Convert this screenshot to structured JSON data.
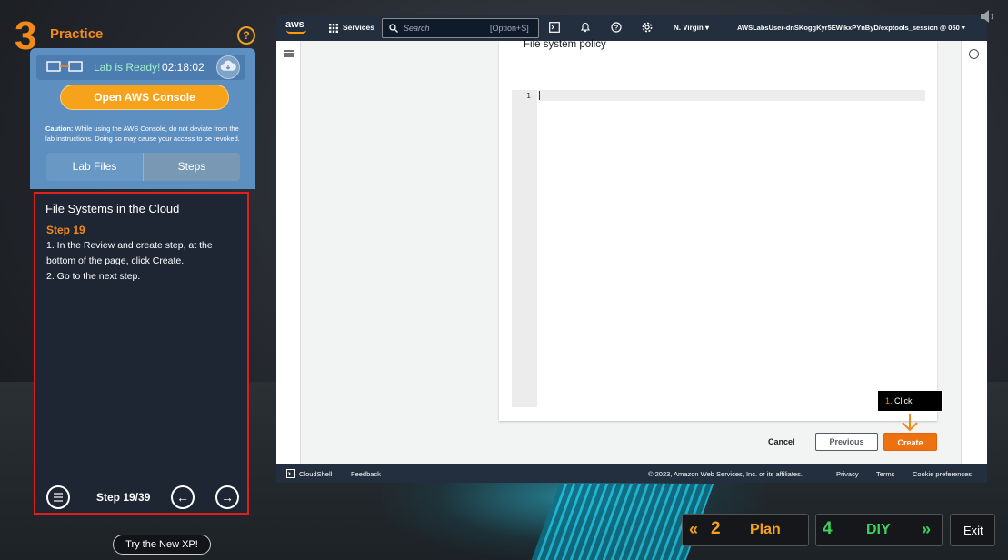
{
  "practice": {
    "number": "3",
    "title": "Practice",
    "help_symbol": "?"
  },
  "lab": {
    "status": "Lab is Ready!",
    "timer": "02:18:02",
    "open_console_label": "Open AWS Console",
    "caution_prefix": "Caution:",
    "caution_text": " While using the AWS Console, do not deviate from the lab instructions. Doing so may cause your access to be revoked.",
    "tabs": [
      {
        "label": "Lab Files"
      },
      {
        "label": "Steps"
      }
    ]
  },
  "steps": {
    "title": "File Systems in the Cloud",
    "step_label": "Step 19",
    "lines": [
      "1. In the Review and create step, at the bottom of the page, click Create.",
      "2. Go to the next step."
    ],
    "counter": "Step 19/39"
  },
  "try_xp_label": "Try the New XP!",
  "aws": {
    "logo": "aws",
    "services": "Services",
    "search_placeholder": "Search",
    "search_shortcut": "[Option+S]",
    "region": "N. Virgin",
    "account": "AWSLabsUser-dnSKoggKyr5EWikxPYnByD/exptools_session @ 050",
    "card_title": "File system policy",
    "line_number": "1",
    "cancel_label": "Cancel",
    "previous_label": "Previous",
    "create_label": "Create",
    "tooltip_num": "1.",
    "tooltip_text": " Click",
    "footer": {
      "cloudshell": "CloudShell",
      "feedback": "Feedback",
      "copyright": "© 2023, Amazon Web Services, Inc. or its affiliates.",
      "privacy": "Privacy",
      "terms": "Terms",
      "cookie": "Cookie preferences"
    }
  },
  "bottom_nav": {
    "plan_num": "2",
    "plan_label": "Plan",
    "diy_num": "4",
    "diy_label": "DIY",
    "exit_label": "Exit"
  },
  "colors": {
    "accent": "#f28a1b",
    "aws_orange": "#ec7211",
    "aws_dark": "#232f3e",
    "diy_green": "#3ad35c"
  }
}
